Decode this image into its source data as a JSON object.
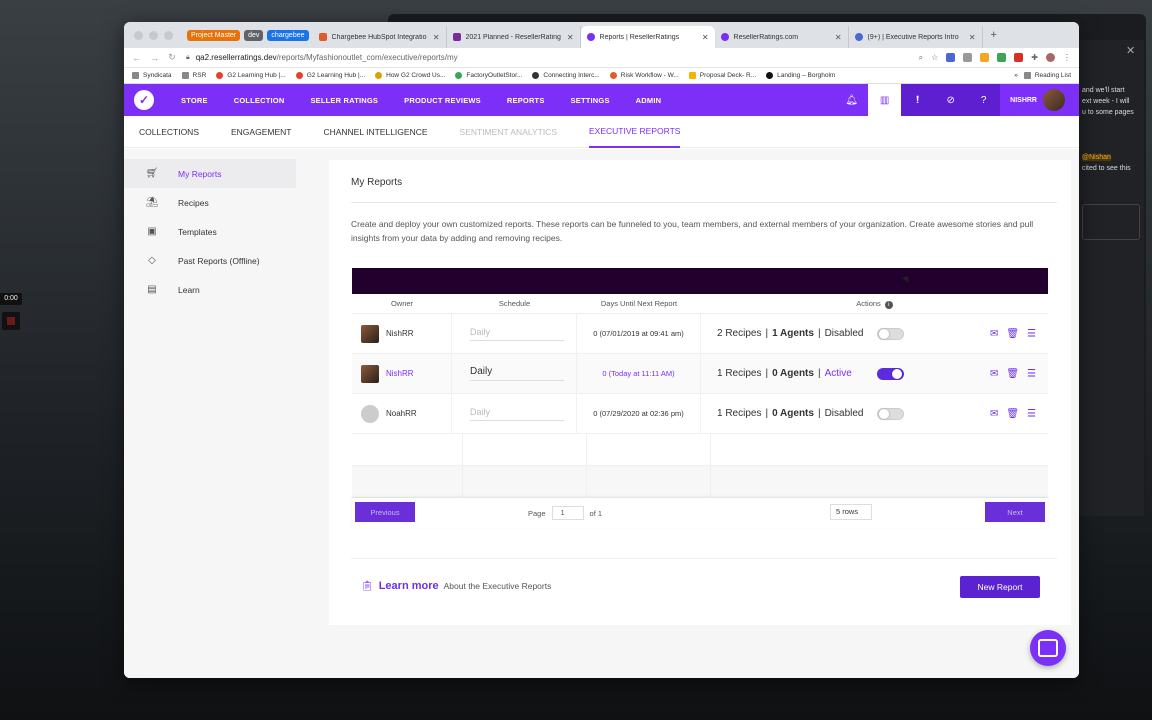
{
  "background": {
    "chat_lines": [
      "and we'll start",
      "ext week - I will",
      "u to some pages"
    ],
    "chat_mention": "@Nishan",
    "chat_line2": "cited to see this",
    "timer": "0:00"
  },
  "browser": {
    "tags": [
      {
        "label": "Project Master",
        "color": "orange"
      },
      {
        "label": "dev",
        "color": "gray"
      },
      {
        "label": "chargebee",
        "color": "blue"
      }
    ],
    "tabs": [
      {
        "title": "Chargebee HubSpot Integratio",
        "fav": "#e05a2b",
        "active": false
      },
      {
        "title": "2021 Planned - ResellerRating",
        "fav": "#7a2a9a",
        "active": false
      },
      {
        "title": "Reports | ResellerRatings",
        "fav": "#7b2ff7",
        "active": true
      },
      {
        "title": "ResellerRatings.com",
        "fav": "#7b2ff7",
        "active": false
      },
      {
        "title": "(9+) | Executive Reports Intro",
        "fav": "#4a67d6",
        "active": false
      }
    ],
    "url_host": "qa2.resellerratings.dev",
    "url_path": "/reports/Myfashionoutlet_com/executive/reports/my",
    "bookmarks": [
      {
        "label": "Syndicata",
        "color": "#888"
      },
      {
        "label": "RSR",
        "color": "#888"
      },
      {
        "label": "G2 Learning Hub |...",
        "color": "#e0442b"
      },
      {
        "label": "G2 Learning Hub |...",
        "color": "#e0442b"
      },
      {
        "label": "How G2 Crowd Us...",
        "color": "#d9a400"
      },
      {
        "label": "FactoryOutletStor...",
        "color": "#3aa655"
      },
      {
        "label": "Connecting Interc...",
        "color": "#333"
      },
      {
        "label": "Risk Workflow - W...",
        "color": "#e05a2b"
      },
      {
        "label": "Proposal Deck- R...",
        "color": "#f4b400"
      },
      {
        "label": "Landing – Borgholm",
        "color": "#111"
      }
    ],
    "reading_list": "Reading List"
  },
  "appnav": {
    "items": [
      "STORE",
      "COLLECTION",
      "SELLER RATINGS",
      "PRODUCT REVIEWS",
      "REPORTS",
      "SETTINGS",
      "ADMIN"
    ],
    "username": "NISHRR"
  },
  "subnav": {
    "items": [
      {
        "label": "COLLECTIONS",
        "state": "normal"
      },
      {
        "label": "ENGAGEMENT",
        "state": "normal"
      },
      {
        "label": "CHANNEL INTELLIGENCE",
        "state": "normal"
      },
      {
        "label": "SENTIMENT ANALYTICS",
        "state": "disabled"
      },
      {
        "label": "EXECUTIVE REPORTS",
        "state": "active"
      }
    ]
  },
  "sidebar": {
    "items": [
      {
        "label": "My Reports",
        "icon": "cart-icon",
        "active": true
      },
      {
        "label": "Recipes",
        "icon": "recipe-icon",
        "active": false
      },
      {
        "label": "Templates",
        "icon": "template-icon",
        "active": false
      },
      {
        "label": "Past Reports (Offline)",
        "icon": "tag-icon",
        "active": false
      },
      {
        "label": "Learn",
        "icon": "book-icon",
        "active": false
      }
    ]
  },
  "main": {
    "title": "My Reports",
    "description": "Create and deploy your own customized reports. These reports can be funneled to you, team members, and external members of your organization. Create awesome stories and pull insights from your data by adding and removing recipes.",
    "columns": [
      "Owner",
      "Schedule",
      "Days Until Next Report",
      "Actions"
    ],
    "rows": [
      {
        "owner": "NishRR",
        "schedule": "Daily",
        "days": "0 (07/01/2019 at 09:41 am)",
        "recipes": "2 Recipes",
        "agents": "1 Agents",
        "status": "Disabled",
        "active": false
      },
      {
        "owner": "NishRR",
        "schedule": "Daily",
        "days": "0 (Today at 11:11 AM)",
        "recipes": "1 Recipes",
        "agents": "0 Agents",
        "status": "Active",
        "active": true
      },
      {
        "owner": "NoahRR",
        "schedule": "Daily",
        "days": "0 (07/29/2020 at 02:36 pm)",
        "recipes": "1 Recipes",
        "agents": "0 Agents",
        "status": "Disabled",
        "active": false
      }
    ],
    "pagination": {
      "previous": "Previous",
      "next": "Next",
      "page_label": "Page",
      "page": "1",
      "of_label": "of 1",
      "rows": "5 rows"
    },
    "learn_more": "Learn more",
    "learn_about": "About the Executive Reports",
    "new_report": "New Report"
  }
}
